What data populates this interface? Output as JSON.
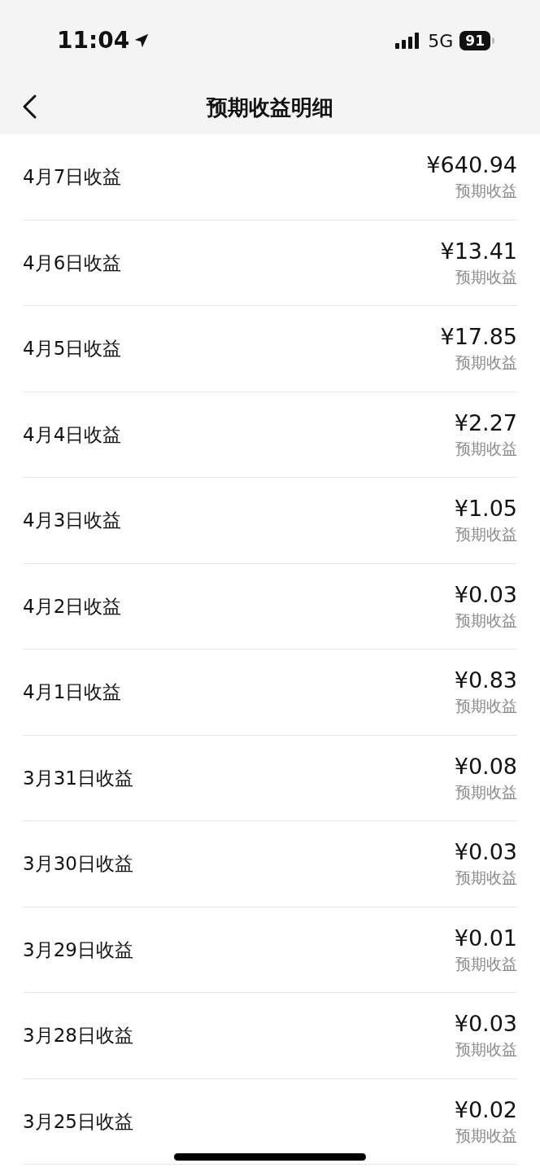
{
  "status_bar": {
    "time": "11:04",
    "network": "5G",
    "battery": "91"
  },
  "nav": {
    "title": "预期收益明细"
  },
  "rows": [
    {
      "label": "4月7日收益",
      "amount": "¥640.94",
      "note": "预期收益"
    },
    {
      "label": "4月6日收益",
      "amount": "¥13.41",
      "note": "预期收益"
    },
    {
      "label": "4月5日收益",
      "amount": "¥17.85",
      "note": "预期收益"
    },
    {
      "label": "4月4日收益",
      "amount": "¥2.27",
      "note": "预期收益"
    },
    {
      "label": "4月3日收益",
      "amount": "¥1.05",
      "note": "预期收益"
    },
    {
      "label": "4月2日收益",
      "amount": "¥0.03",
      "note": "预期收益"
    },
    {
      "label": "4月1日收益",
      "amount": "¥0.83",
      "note": "预期收益"
    },
    {
      "label": "3月31日收益",
      "amount": "¥0.08",
      "note": "预期收益"
    },
    {
      "label": "3月30日收益",
      "amount": "¥0.03",
      "note": "预期收益"
    },
    {
      "label": "3月29日收益",
      "amount": "¥0.01",
      "note": "预期收益"
    },
    {
      "label": "3月28日收益",
      "amount": "¥0.03",
      "note": "预期收益"
    },
    {
      "label": "3月25日收益",
      "amount": "¥0.02",
      "note": "预期收益"
    }
  ]
}
